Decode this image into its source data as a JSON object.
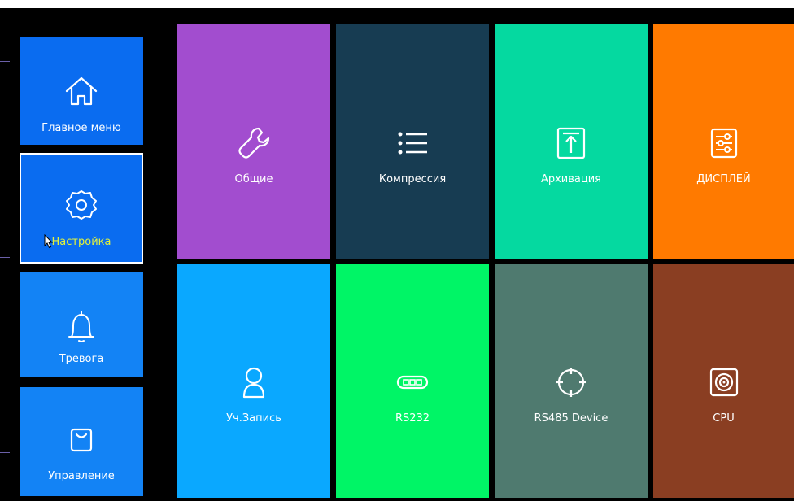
{
  "sidebar": {
    "items": [
      {
        "label": "Главное меню",
        "icon": "home-icon"
      },
      {
        "label": "Настройка",
        "icon": "gear-icon",
        "active": true
      },
      {
        "label": "Тревога",
        "icon": "bell-icon"
      },
      {
        "label": "Управление",
        "icon": "bag-icon"
      }
    ]
  },
  "grid": {
    "tiles": [
      {
        "label": "Общие",
        "icon": "wrench-icon",
        "color": "#a24dcf"
      },
      {
        "label": "Компрессия",
        "icon": "list-icon",
        "color": "#173c52"
      },
      {
        "label": "Архивация",
        "icon": "upload-icon",
        "color": "#05d9a0"
      },
      {
        "label": "ДИСПЛЕЙ",
        "icon": "sliders-icon",
        "color": "#ff7a00"
      },
      {
        "label": "Уч.Запись",
        "icon": "user-icon",
        "color": "#0aa8ff"
      },
      {
        "label": "RS232",
        "icon": "serial-port-icon",
        "color": "#00f566"
      },
      {
        "label": "RS485 Device",
        "icon": "crosshair-icon",
        "color": "#4f7a6f"
      },
      {
        "label": "CPU",
        "icon": "speaker-icon",
        "color": "#8a3e22"
      }
    ]
  },
  "colors": {
    "sidebar_blue_1": "#0a6cf0",
    "sidebar_blue_2": "#1383f5",
    "active_label": "#e3f33a",
    "background": "#000000"
  }
}
